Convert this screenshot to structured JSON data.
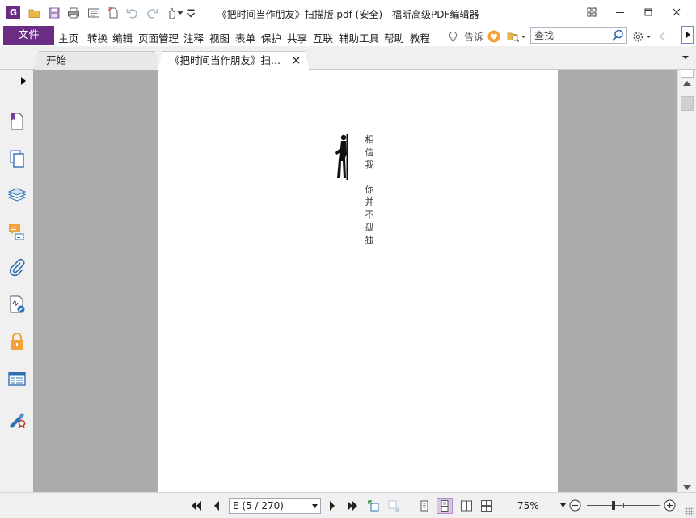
{
  "window": {
    "title": "《把时间当作朋友》扫描版.pdf (安全) - 福昕高级PDF编辑器",
    "app_logo_letter": "G"
  },
  "menu": {
    "file": "文件",
    "items": [
      "主页",
      "转换",
      "编辑",
      "页面管理",
      "注释",
      "视图",
      "表单",
      "保护",
      "共享",
      "互联",
      "辅助工具",
      "帮助",
      "教程"
    ],
    "tell_me": "告诉",
    "search_value": "查找"
  },
  "tabs": [
    {
      "label": "开始",
      "active": false
    },
    {
      "label": "《把时间当作朋友》扫...",
      "active": true
    }
  ],
  "document": {
    "column1": [
      "相",
      "信",
      "我"
    ],
    "column2": [
      "你",
      "并",
      "不",
      "孤",
      "独"
    ]
  },
  "status": {
    "page_value": "E (5 / 270)",
    "zoom": "75%",
    "zoom_level": 0.37
  },
  "colors": {
    "accent": "#6b2c83",
    "page_bg": "#ababab",
    "icon_blue": "#2f6fb4",
    "icon_purple": "#7b3f9a"
  }
}
